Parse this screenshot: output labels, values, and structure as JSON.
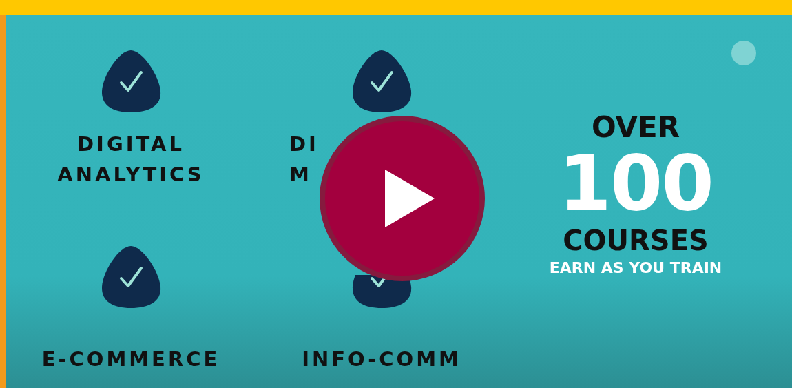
{
  "features": [
    {
      "kind": "full",
      "lines": [
        "DIGITAL",
        "ANALYTICS"
      ]
    },
    {
      "kind": "partial",
      "lines": [
        "DI",
        "M"
      ]
    },
    {
      "kind": "full",
      "lines": [
        "E-COMMERCE"
      ]
    },
    {
      "kind": "covered",
      "lines": [
        "INFO-COMM"
      ]
    }
  ],
  "promo": {
    "over": "OVER",
    "number": "100",
    "courses": "COURSES",
    "tagline": "EARN AS YOU TRAIN"
  }
}
